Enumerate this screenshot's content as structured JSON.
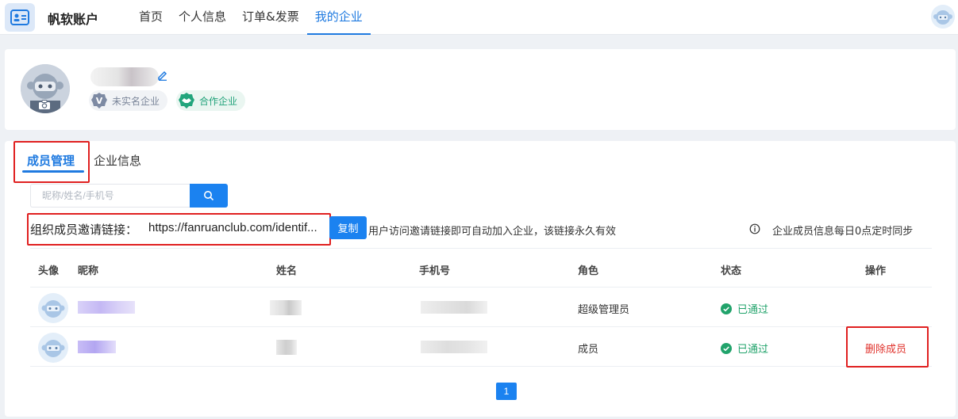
{
  "brand": "帆软账户",
  "nav": {
    "items": [
      {
        "label": "首页"
      },
      {
        "label": "个人信息"
      },
      {
        "label": "订单&发票"
      },
      {
        "label": "我的企业"
      }
    ],
    "active_index": 3
  },
  "profile": {
    "badges": [
      {
        "label": "未实名企业",
        "icon": "v-badge-icon"
      },
      {
        "label": "合作企业",
        "icon": "handshake-icon"
      }
    ]
  },
  "tabs": [
    {
      "label": "成员管理"
    },
    {
      "label": "企业信息"
    }
  ],
  "search": {
    "placeholder": "昵称/姓名/手机号"
  },
  "invite": {
    "label": "组织成员邀请链接：",
    "link": "https://fanruanclub.com/identif...",
    "copy_label": "复制",
    "tip": "用户访问邀请链接即可自动加入企业，该链接永久有效"
  },
  "sync_tip": "企业成员信息每日0点定时同步",
  "table": {
    "headers": [
      "头像",
      "昵称",
      "姓名",
      "手机号",
      "角色",
      "状态",
      "操作"
    ],
    "rows": [
      {
        "role": "超级管理员",
        "status": "已通过",
        "action": ""
      },
      {
        "role": "成员",
        "status": "已通过",
        "action": "删除成员"
      }
    ]
  },
  "pagination": {
    "current": "1"
  },
  "colors": {
    "accent": "#1b82f0",
    "success": "#21a36b",
    "danger": "#e0322c",
    "highlight_box": "#e02020"
  }
}
